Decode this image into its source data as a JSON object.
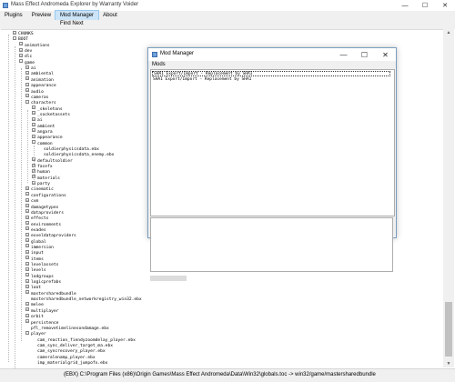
{
  "window": {
    "title": "Mass Effect Andromeda Explorer by Warranty Voider",
    "controls": {
      "minimize": "—",
      "maximize": "☐",
      "close": "✕"
    }
  },
  "menu": [
    "Plugins",
    "Preview",
    "Mod Manager",
    "About"
  ],
  "toolbar": {
    "find_next": "Find Next"
  },
  "tree": [
    {
      "label": "CHUNKS",
      "toggle": "+"
    },
    {
      "label": "BOOT",
      "toggle": "-"
    },
    {
      "label": "animations",
      "toggle": "+"
    },
    {
      "label": "dev",
      "toggle": "+"
    },
    {
      "label": "dlc",
      "toggle": "+"
    },
    {
      "label": "game",
      "toggle": "-"
    },
    {
      "label": "ai",
      "toggle": "+"
    },
    {
      "label": "ambiental",
      "toggle": "+"
    },
    {
      "label": "animation",
      "toggle": "+"
    },
    {
      "label": "appearance",
      "toggle": "+"
    },
    {
      "label": "audio",
      "toggle": "+"
    },
    {
      "label": "cameras",
      "toggle": "+"
    },
    {
      "label": "characters",
      "toggle": "-"
    },
    {
      "label": "_skeletons",
      "toggle": "+"
    },
    {
      "label": "_socketassets",
      "toggle": "+"
    },
    {
      "label": "ai",
      "toggle": "+"
    },
    {
      "label": "ambient",
      "toggle": "+"
    },
    {
      "label": "angara",
      "toggle": "+"
    },
    {
      "label": "appearance",
      "toggle": "+"
    },
    {
      "label": "common",
      "toggle": "-"
    },
    {
      "label": "soldierphysicsdata.ebx",
      "toggle": ""
    },
    {
      "label": "soldierphysicsdata_enemy.ebx",
      "toggle": ""
    },
    {
      "label": "defaultsoldier",
      "toggle": "+"
    },
    {
      "label": "facefx",
      "toggle": "+"
    },
    {
      "label": "human",
      "toggle": "+"
    },
    {
      "label": "materials",
      "toggle": "+"
    },
    {
      "label": "party",
      "toggle": "+"
    },
    {
      "label": "cinematic",
      "toggle": "+"
    },
    {
      "label": "configurations",
      "toggle": "+"
    },
    {
      "label": "cvm",
      "toggle": "+"
    },
    {
      "label": "damagetypes",
      "toggle": "+"
    },
    {
      "label": "dataproviders",
      "toggle": "+"
    },
    {
      "label": "effects",
      "toggle": "+"
    },
    {
      "label": "environments",
      "toggle": "+"
    },
    {
      "label": "evades",
      "toggle": "+"
    },
    {
      "label": "exveldataproviders",
      "toggle": "+"
    },
    {
      "label": "global",
      "toggle": "+"
    },
    {
      "label": "immersion",
      "toggle": "+"
    },
    {
      "label": "input",
      "toggle": "+"
    },
    {
      "label": "items",
      "toggle": "+"
    },
    {
      "label": "levelassets",
      "toggle": "+"
    },
    {
      "label": "levels",
      "toggle": "+"
    },
    {
      "label": "lodgroups",
      "toggle": "+"
    },
    {
      "label": "logicprefabs",
      "toggle": "+"
    },
    {
      "label": "loot",
      "toggle": "+"
    },
    {
      "label": "mastersharedbundle",
      "toggle": "+"
    },
    {
      "label": "mastersharedbundle_networkregistry_win32.ebx",
      "toggle": ""
    },
    {
      "label": "melee",
      "toggle": "+"
    },
    {
      "label": "multiplayer",
      "toggle": "+"
    },
    {
      "label": "orbit",
      "toggle": "+"
    },
    {
      "label": "persistence",
      "toggle": "+"
    },
    {
      "label": "pfl_removetimelinesondamage.ebx",
      "toggle": ""
    },
    {
      "label": "player",
      "toggle": "-"
    },
    {
      "label": "cam_reaction_fiendyzoomdelay_player.ebx",
      "toggle": ""
    },
    {
      "label": "cam_sync_deliver_target_ma.ebx",
      "toggle": ""
    },
    {
      "label": "cam_syncrecovery_player.ebx",
      "toggle": ""
    },
    {
      "label": "cameralenamp_player.ebx",
      "toggle": ""
    },
    {
      "label": "imp_materialgrid_jumpofx.ebx",
      "toggle": ""
    }
  ],
  "status": {
    "text": "(EBX) C:\\Program Files (x86)\\Origin Games\\Mass Effect Andromeda\\Data\\Win32\\globals.toc -> win32/game/mastersharedbundle"
  },
  "mod_manager": {
    "title": "Mod Manager",
    "menu": "Mods",
    "items": [
      "SHA1 Export/Import - Replacement by SHA1",
      "SHA1 Export/Import - Replacement by SHA1"
    ],
    "controls": {
      "minimize": "—",
      "maximize": "☐",
      "close": "✕"
    }
  }
}
